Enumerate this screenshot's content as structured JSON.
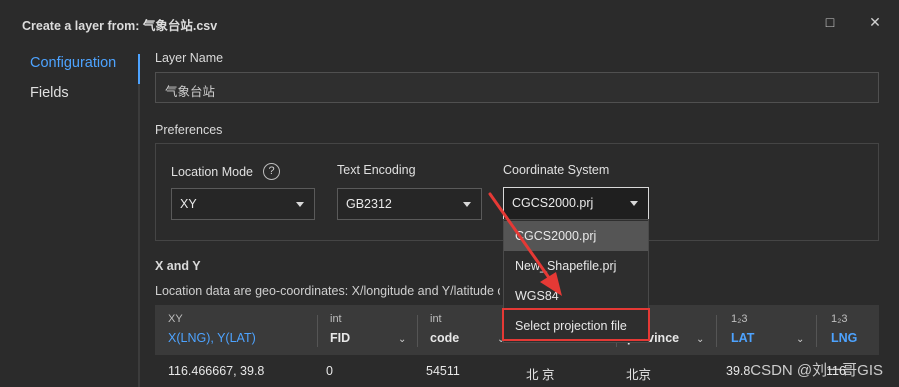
{
  "window": {
    "title": "Create a layer from: 气象台站.csv",
    "maximize_icon": "□",
    "close_icon": "✕"
  },
  "nav": {
    "items": [
      {
        "label": "Configuration",
        "active": true
      },
      {
        "label": "Fields",
        "active": false
      }
    ]
  },
  "layer_name": {
    "label": "Layer Name",
    "value": "气象台站"
  },
  "preferences": {
    "label": "Preferences",
    "location_mode": {
      "label": "Location Mode",
      "help": "?",
      "value": "XY"
    },
    "text_encoding": {
      "label": "Text Encoding",
      "value": "GB2312"
    },
    "coordinate_system": {
      "label": "Coordinate System",
      "value": "CGCS2000.prj",
      "options": [
        "CGCS2000.prj",
        "New_Shapefile.prj",
        "WGS84",
        "Select projection file"
      ],
      "selected_index": 0,
      "highlighted_option": "Select projection file"
    }
  },
  "xy_section": {
    "label": "X and Y",
    "description": "Location data are geo-coordinates: X/longitude and Y/latitude o"
  },
  "table": {
    "columns": [
      {
        "type": "XY",
        "name": "X(LNG), Y(LAT)"
      },
      {
        "type": "int",
        "name": "FID"
      },
      {
        "type": "int",
        "name": "code"
      },
      {
        "type": "",
        "name": ""
      },
      {
        "type": "",
        "name": "province"
      },
      {
        "type": "1₂3",
        "name": "LAT"
      },
      {
        "type": "1₂3",
        "name": "LNG"
      }
    ],
    "row": {
      "xy": "116.466667, 39.8",
      "fid": "0",
      "code": "54511",
      "name": "北 京",
      "province": "北京",
      "lat": "39.8",
      "lng": "116"
    }
  },
  "watermark": "CSDN @刘一哥GIS",
  "colors": {
    "accent": "#4da3ff",
    "highlight_border": "#e53935",
    "background": "#2b2b2b"
  }
}
